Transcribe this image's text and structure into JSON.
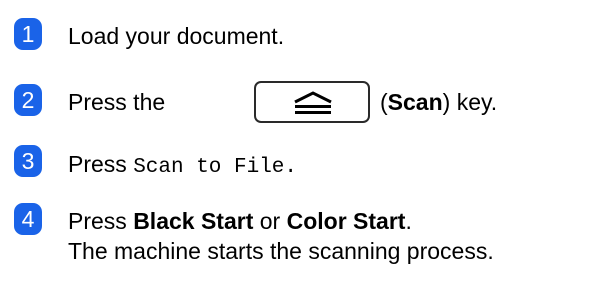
{
  "steps": [
    {
      "number": "1",
      "text": "Load your document."
    },
    {
      "number": "2",
      "prefix": "Press the",
      "key_icon": "scan-key-icon",
      "paren_open": "(",
      "key_name": "Scan",
      "suffix": ") key."
    },
    {
      "number": "3",
      "prefix": "Press",
      "menu_item": "Scan to File."
    },
    {
      "number": "4",
      "prefix": "Press",
      "option1": "Black Start",
      "connector": "or",
      "option2": "Color Start",
      "end": ".",
      "note": "The machine starts the scanning process."
    }
  ],
  "colors": {
    "badge": "#1a63e8",
    "text": "#000000"
  }
}
